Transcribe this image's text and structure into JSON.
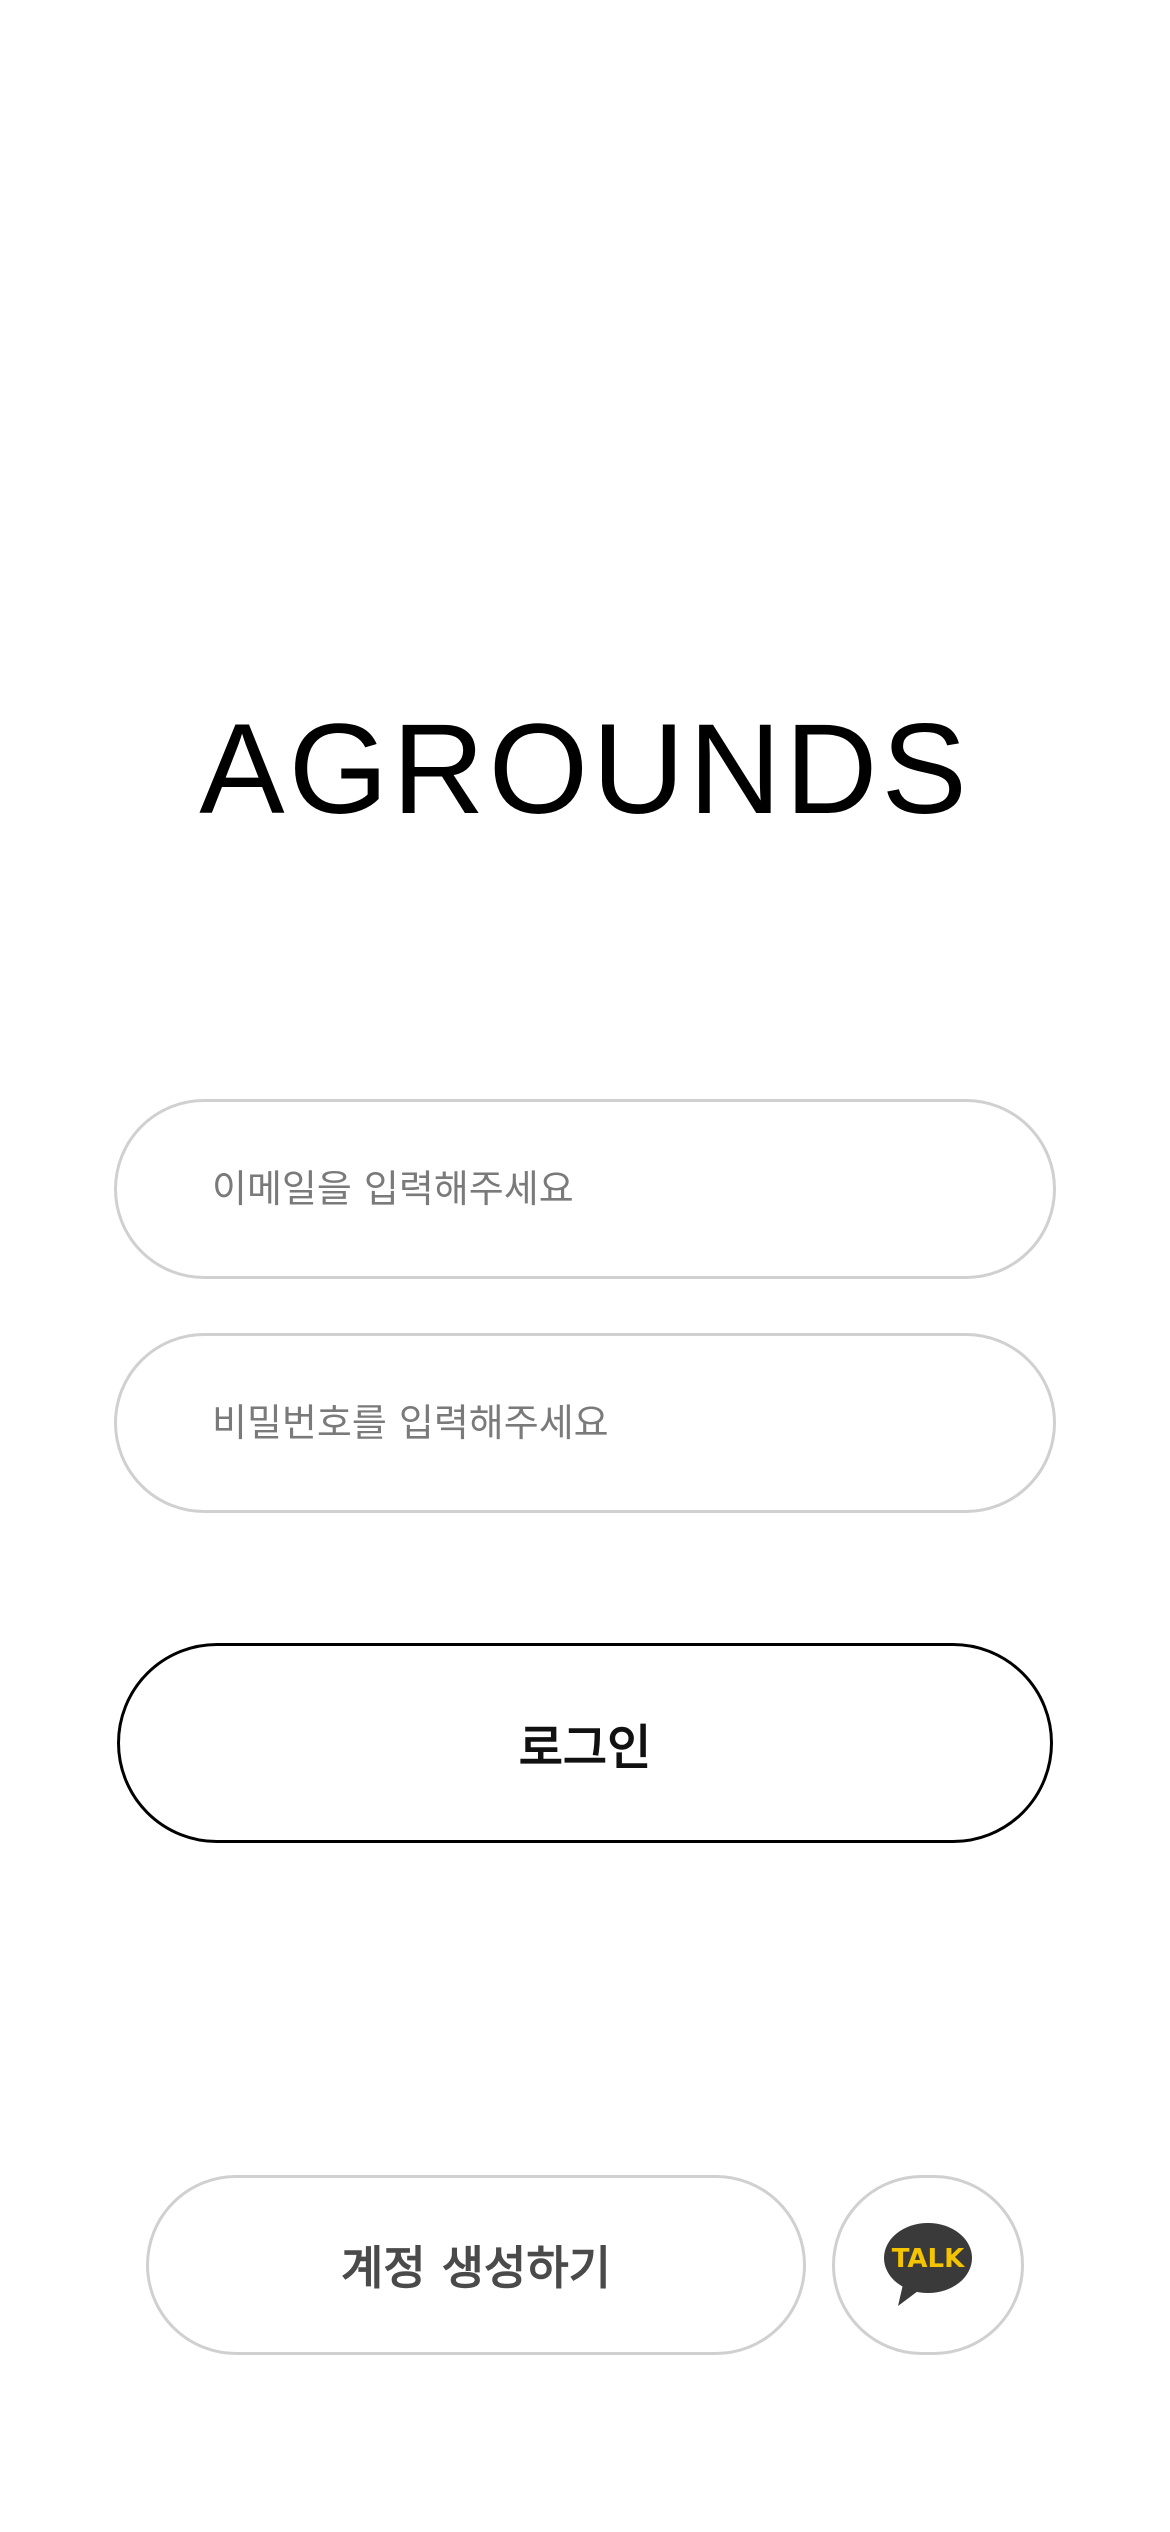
{
  "app": {
    "title": "AGROUNDS"
  },
  "login_form": {
    "email_placeholder": "이메일을 입력해주세요",
    "email_value": "",
    "password_placeholder": "비밀번호를 입력해주세요",
    "password_value": "",
    "login_label": "로그인"
  },
  "footer": {
    "signup_label": "계정 생성하기",
    "kakao_icon": "kakao-talk-icon",
    "kakao_icon_text": "TALK"
  },
  "colors": {
    "background": "#ffffff",
    "border_light": "#d0d0d0",
    "border_dark": "#000000",
    "placeholder": "#7a7a7a",
    "kakao_bubble": "#3a3a3a",
    "kakao_text": "#f5c400"
  }
}
